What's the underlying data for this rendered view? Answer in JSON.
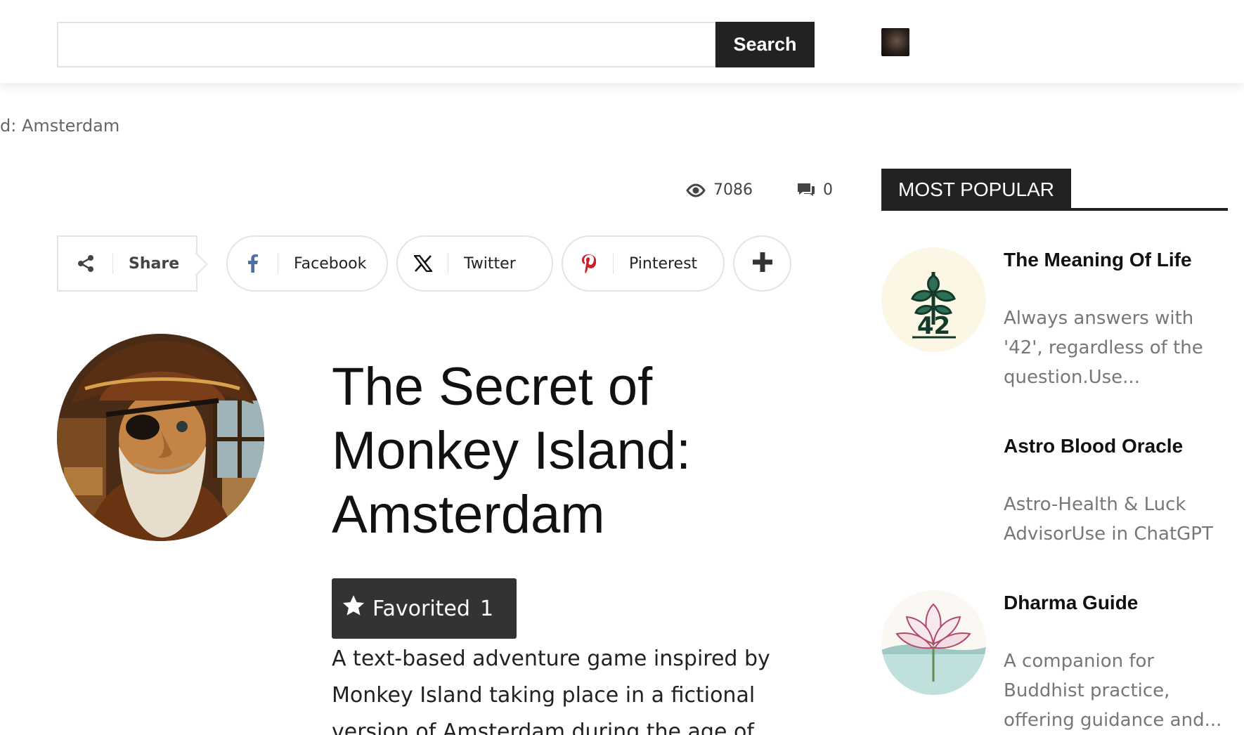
{
  "header": {
    "search_placeholder": "",
    "search_button": "Search"
  },
  "breadcrumb": "d: Amsterdam",
  "meta": {
    "views": "7086",
    "comments": "0"
  },
  "share": {
    "label": "Share",
    "facebook": "Facebook",
    "twitter": "Twitter",
    "pinterest": "Pinterest"
  },
  "post": {
    "title": "The Secret of Monkey Island: Amsterdam",
    "favorite_label": "Favorited",
    "favorite_count": "1",
    "description": "A text-based adventure game inspired by Monkey Island taking place in a fictional version of Amsterdam during the age of"
  },
  "sidebar": {
    "heading": "MOST POPULAR",
    "items": [
      {
        "title": "The Meaning Of Life",
        "desc": "Always answers with '42', regardless of the question.Use..."
      },
      {
        "title": "Astro Blood Oracle",
        "desc": "Astro-Health & Luck AdvisorUse in ChatGPT"
      },
      {
        "title": "Dharma Guide",
        "desc": "A companion for Buddhist practice, offering guidance and..."
      }
    ]
  },
  "icons": {
    "share": "share-icon",
    "facebook": "facebook-icon",
    "twitter": "x-icon",
    "pinterest": "pinterest-icon",
    "more": "plus-icon",
    "views": "eye-icon",
    "comments": "comment-icon",
    "favorite": "star-icon"
  },
  "colors": {
    "dark": "#222222",
    "facebook": "#516eab",
    "pinterest": "#ca212a",
    "muted_text": "#777777"
  }
}
